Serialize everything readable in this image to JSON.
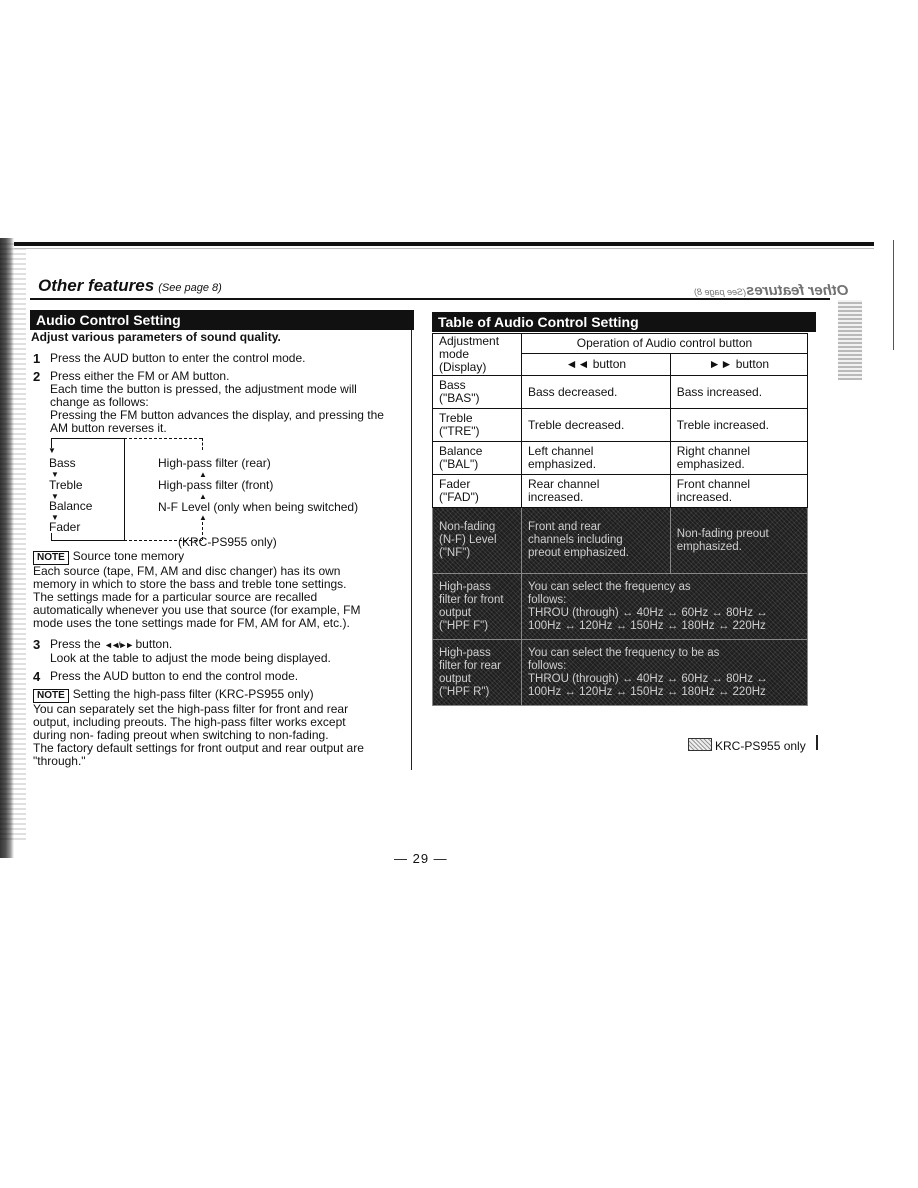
{
  "page": {
    "section_header": "Other features",
    "section_header_ref": "(See page 8)",
    "page_number": "— 29 —"
  },
  "left": {
    "title": "Audio Control Setting",
    "intro": "Adjust various parameters of sound quality.",
    "steps": [
      {
        "num": "1",
        "lines": [
          "Press the AUD button to enter the control mode."
        ]
      },
      {
        "num": "2",
        "lines": [
          "Press either the FM or AM button.",
          "Each time the button is pressed, the adjustment mode will",
          "change as follows:",
          "Pressing the FM button advances the display, and pressing the",
          "AM button reverses it."
        ]
      },
      {
        "num": "3",
        "lines_pre": "Press the ",
        "icon": "prev-next-icon",
        "icon_glyph": "◄◄/►►",
        "lines_post": " button.",
        "line2": "Look at the table to adjust the mode being displayed."
      },
      {
        "num": "4",
        "lines": [
          "Press the AUD button to end the control mode."
        ]
      }
    ],
    "flow": {
      "left_items": [
        "Bass",
        "Treble",
        "Balance",
        "Fader"
      ],
      "right_items": [
        "High-pass filter (rear)",
        "High-pass filter (front)",
        "N-F Level (only when being switched)"
      ],
      "note": "(KRC-PS955 only)"
    },
    "notes": [
      {
        "badge": "NOTE",
        "title": "Source tone memory",
        "lines": [
          "Each source (tape, FM, AM and disc changer) has its own",
          "memory in which to store the bass and treble tone settings.",
          "The settings made for a particular source are recalled",
          "automatically whenever you use that source (for example, FM",
          "mode uses the tone settings made for FM, AM for AM, etc.)."
        ]
      },
      {
        "badge": "NOTE",
        "title": "Setting the high-pass filter  (KRC-PS955 only)",
        "lines": [
          "You can separately set the high-pass filter for front and rear",
          "output, including preouts. The high-pass filter works except",
          "during non- fading preout when switching to non-fading.",
          "The factory default settings for front output and rear output are",
          "\"through.\""
        ]
      }
    ]
  },
  "right": {
    "title": "Table of Audio Control Setting",
    "table": {
      "header_mode": [
        "Adjustment",
        "mode",
        "(Display)"
      ],
      "header_operation": "Operation of Audio control button",
      "header_prev": "◄◄ button",
      "header_next": "►► button",
      "rows": [
        {
          "mode": [
            "Bass",
            "(\"BAS\")"
          ],
          "prev": [
            "Bass decreased."
          ],
          "next": [
            "Bass increased."
          ],
          "krc_only": false
        },
        {
          "mode": [
            "Treble",
            "(\"TRE\")"
          ],
          "prev": [
            "Treble decreased."
          ],
          "next": [
            "Treble increased."
          ],
          "krc_only": false
        },
        {
          "mode": [
            "Balance",
            "(\"BAL\")"
          ],
          "prev": [
            "Left channel",
            "emphasized."
          ],
          "next": [
            "Right channel",
            "emphasized."
          ],
          "krc_only": false
        },
        {
          "mode": [
            "Fader",
            "(\"FAD\")"
          ],
          "prev": [
            "Rear channel",
            "increased."
          ],
          "next": [
            "Front channel",
            "increased."
          ],
          "krc_only": false
        },
        {
          "mode": [
            "Non-fading",
            "(N-F) Level",
            "(\"NF\")"
          ],
          "prev": [
            "Front and rear",
            "channels including",
            "preout emphasized."
          ],
          "next": [
            "Non-fading preout",
            "emphasized."
          ],
          "krc_only": true
        },
        {
          "mode": [
            "High-pass",
            "filter for front",
            "output",
            "(\"HPF F\")"
          ],
          "wide": [
            "You can select the frequency as",
            "follows:",
            "THROU (through) ↔ 40Hz ↔ 60Hz ↔ 80Hz ↔",
            "100Hz ↔ 120Hz ↔ 150Hz ↔ 180Hz ↔ 220Hz"
          ],
          "krc_only": true
        },
        {
          "mode": [
            "High-pass",
            "filter for rear",
            "output",
            "(\"HPF R\")"
          ],
          "wide": [
            "You can select the frequency to be as",
            "follows:",
            "THROU (through) ↔ 40Hz ↔ 60Hz ↔ 80Hz ↔",
            "100Hz ↔ 120Hz ↔ 150Hz ↔ 180Hz ↔ 220Hz"
          ],
          "krc_only": true
        }
      ]
    },
    "legend": "KRC-PS955 only"
  }
}
